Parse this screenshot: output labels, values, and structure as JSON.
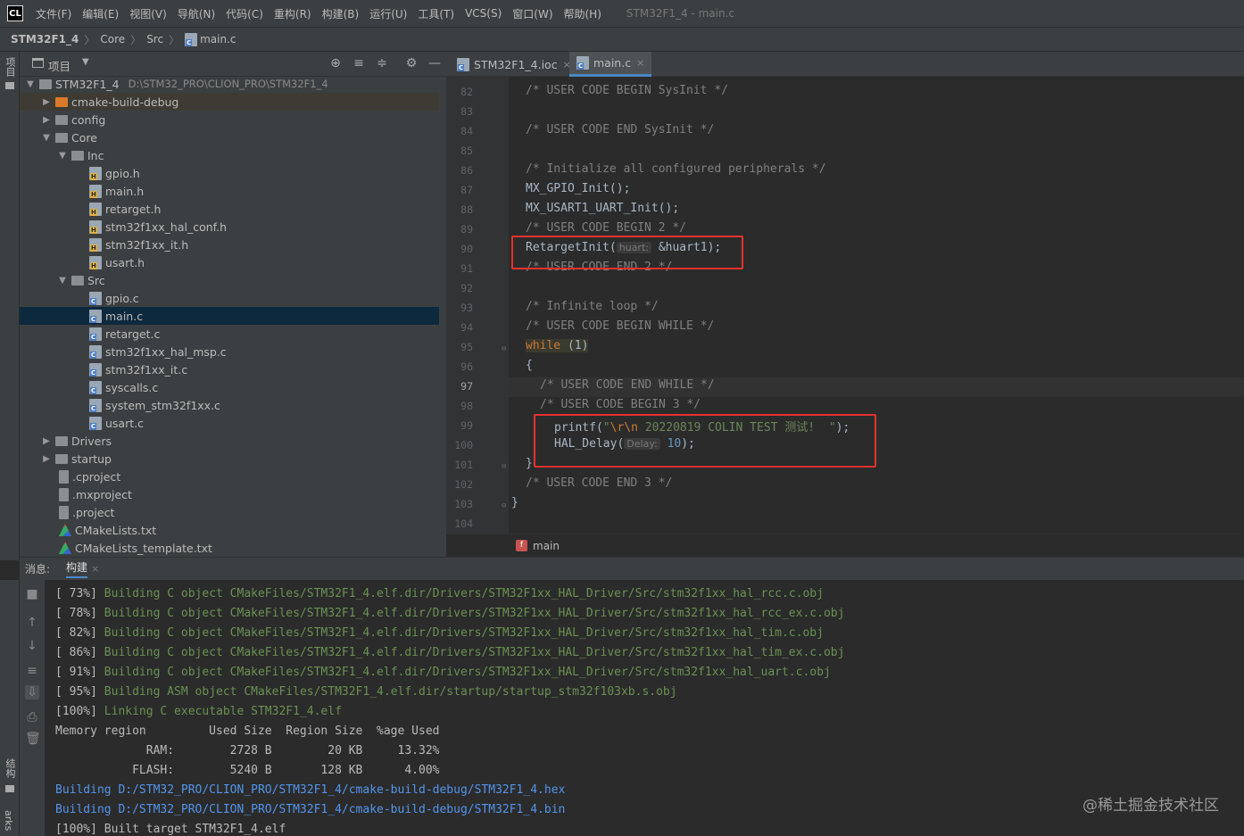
{
  "app": {
    "logo": "CL",
    "window_title": "STM32F1_4 - main.c"
  },
  "menu": [
    "文件(F)",
    "编辑(E)",
    "视图(V)",
    "导航(N)",
    "代码(C)",
    "重构(R)",
    "构建(B)",
    "运行(U)",
    "工具(T)",
    "VCS(S)",
    "窗口(W)",
    "帮助(H)"
  ],
  "breadcrumb": [
    "STM32F1_4",
    "Core",
    "Src",
    "main.c"
  ],
  "left_tabs": {
    "project": "项目",
    "structure": "结构",
    "bookmarks": "arks"
  },
  "project_panel": {
    "title": "项目",
    "root_name": "STM32F1_4",
    "root_path": "D:\\STM32_PRO\\CLION_PRO\\STM32F1_4",
    "items": [
      {
        "label": "cmake-build-debug"
      },
      {
        "label": "config"
      },
      {
        "label": "Core"
      },
      {
        "label": "Inc"
      },
      {
        "label": "gpio.h"
      },
      {
        "label": "main.h"
      },
      {
        "label": "retarget.h"
      },
      {
        "label": "stm32f1xx_hal_conf.h"
      },
      {
        "label": "stm32f1xx_it.h"
      },
      {
        "label": "usart.h"
      },
      {
        "label": "Src"
      },
      {
        "label": "gpio.c"
      },
      {
        "label": "main.c"
      },
      {
        "label": "retarget.c"
      },
      {
        "label": "stm32f1xx_hal_msp.c"
      },
      {
        "label": "stm32f1xx_it.c"
      },
      {
        "label": "syscalls.c"
      },
      {
        "label": "system_stm32f1xx.c"
      },
      {
        "label": "usart.c"
      },
      {
        "label": "Drivers"
      },
      {
        "label": "startup"
      },
      {
        "label": ".cproject"
      },
      {
        "label": ".mxproject"
      },
      {
        "label": ".project"
      },
      {
        "label": "CMakeLists.txt"
      },
      {
        "label": "CMakeLists_template.txt"
      }
    ]
  },
  "editor": {
    "tabs": [
      {
        "label": "STM32F1_4.ioc",
        "active": false
      },
      {
        "label": "main.c",
        "active": true
      }
    ],
    "line_numbers": [
      "82",
      "83",
      "84",
      "85",
      "86",
      "87",
      "88",
      "89",
      "90",
      "91",
      "92",
      "93",
      "94",
      "95",
      "96",
      "97",
      "98",
      "99",
      "100",
      "101",
      "102",
      "103",
      "104"
    ],
    "current_line": "97",
    "code": {
      "l82": "/* USER CODE BEGIN SysInit */",
      "l84": "/* USER CODE END SysInit */",
      "l86": "/* Initialize all configured peripherals */",
      "l87": "MX_GPIO_Init();",
      "l88": "MX_USART1_UART_Init();",
      "l89": "/* USER CODE BEGIN 2 */",
      "l90_fn": "RetargetInit(",
      "l90_hint": "huart:",
      "l90_arg": "&huart1);",
      "l91": "/* USER CODE END 2 */",
      "l93": "/* Infinite loop */",
      "l94": "/* USER CODE BEGIN WHILE */",
      "l95_kw": "while",
      "l95_rest": " (1)",
      "l96": "{",
      "l97": "/* USER CODE END WHILE */",
      "l98": "/* USER CODE BEGIN 3 */",
      "l99_fn": "printf(",
      "l99_q1": "\"",
      "l99_esc": "\\r\\n",
      "l99_str": " 20220819 COLIN TEST 测试!  \"",
      "l99_end": ");",
      "l100_fn": "HAL_Delay(",
      "l100_hint": "Delay:",
      "l100_num": "10",
      "l100_end": ");",
      "l101": "}",
      "l102": "/* USER CODE END 3 */",
      "l103": "}"
    },
    "func_breadcrumb": "main",
    "func_badge": "f"
  },
  "messages": {
    "label": "消息:",
    "tab": "构建"
  },
  "build_output": [
    {
      "pct": "[ 73%]",
      "text": " Building C object CMakeFiles/STM32F1_4.elf.dir/Drivers/STM32F1xx_HAL_Driver/Src/stm32f1xx_hal_rcc.c.obj"
    },
    {
      "pct": "[ 78%]",
      "text": " Building C object CMakeFiles/STM32F1_4.elf.dir/Drivers/STM32F1xx_HAL_Driver/Src/stm32f1xx_hal_rcc_ex.c.obj"
    },
    {
      "pct": "[ 82%]",
      "text": " Building C object CMakeFiles/STM32F1_4.elf.dir/Drivers/STM32F1xx_HAL_Driver/Src/stm32f1xx_hal_tim.c.obj"
    },
    {
      "pct": "[ 86%]",
      "text": " Building C object CMakeFiles/STM32F1_4.elf.dir/Drivers/STM32F1xx_HAL_Driver/Src/stm32f1xx_hal_tim_ex.c.obj"
    },
    {
      "pct": "[ 91%]",
      "text": " Building C object CMakeFiles/STM32F1_4.elf.dir/Drivers/STM32F1xx_HAL_Driver/Src/stm32f1xx_hal_uart.c.obj"
    },
    {
      "pct": "[ 95%]",
      "text": " Building ASM object CMakeFiles/STM32F1_4.elf.dir/startup/startup_stm32f103xb.s.obj"
    },
    {
      "pct": "[100%]",
      "text": " Linking C executable STM32F1_4.elf"
    }
  ],
  "memory_table": {
    "header": "Memory region         Used Size  Region Size  %age Used",
    "ram": "             RAM:        2728 B        20 KB     13.32%",
    "flash": "           FLASH:        5240 B       128 KB      4.00%"
  },
  "build_links": [
    "Building D:/STM32_PRO/CLION_PRO/STM32F1_4/cmake-build-debug/STM32F1_4.hex",
    "Building D:/STM32_PRO/CLION_PRO/STM32F1_4/cmake-build-debug/STM32F1_4.bin"
  ],
  "build_final": "[100%] Built target STM32F1_4.elf",
  "watermark": "@稀土掘金技术社区",
  "colors": {
    "highlight_box": "#e8312d",
    "selection": "#0d293e",
    "accent": "#4a88c7"
  }
}
